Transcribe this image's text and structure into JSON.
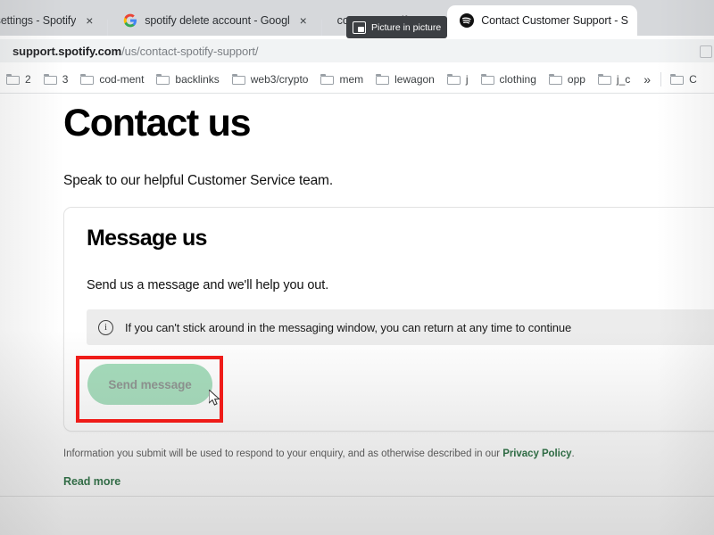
{
  "browser": {
    "tabs": [
      {
        "title": "vacy settings - Spotify",
        "favicon": "none",
        "active": false,
        "close_label": "×"
      },
      {
        "title": "spotify delete account - Googl",
        "favicon": "google-icon",
        "active": false,
        "close_label": "×"
      },
      {
        "title": "ccount - Spotify",
        "favicon": "none",
        "active": false,
        "close_label": "×"
      },
      {
        "title": "Contact Customer Support - S",
        "favicon": "spotify-icon",
        "active": true,
        "close_label": ""
      }
    ],
    "tooltip": {
      "label": "Picture in picture",
      "icon": "picture-in-picture-icon"
    },
    "url": {
      "host": "support.spotify.com",
      "path": "/us/contact-spotify-support/"
    },
    "bookmarks": [
      {
        "label": "2"
      },
      {
        "label": "3"
      },
      {
        "label": "cod-ment"
      },
      {
        "label": "backlinks"
      },
      {
        "label": "web3/crypto"
      },
      {
        "label": "mem"
      },
      {
        "label": "lewagon"
      },
      {
        "label": "j"
      },
      {
        "label": "clothing"
      },
      {
        "label": "opp"
      },
      {
        "label": "j_c"
      }
    ],
    "bookmarks_overflow_label": "»",
    "bookmarks_clipped": [
      {
        "label": "C"
      }
    ]
  },
  "page": {
    "title": "Contact us",
    "subtitle": "Speak to our helpful Customer Service team.",
    "card": {
      "title": "Message us",
      "subtitle": "Send us a message and we'll help you out.",
      "info_banner": {
        "icon": "info-circle-icon",
        "text": "If you can't stick around in the messaging window, you can return at any time to continue"
      },
      "send_button": {
        "label": "Send message",
        "state": "disabled",
        "bg_color": "#a3dcba",
        "text_color": "#8a8f8c"
      }
    },
    "footnote": {
      "text_before": "Information you submit will be used to respond to your enquiry, and as otherwise described in our ",
      "link_label": "Privacy Policy",
      "text_after": "."
    },
    "read_more_label": "Read more",
    "link_color": "#14612f"
  },
  "annotation": {
    "highlight_color": "#ef1c19",
    "target": "send-message-button"
  }
}
